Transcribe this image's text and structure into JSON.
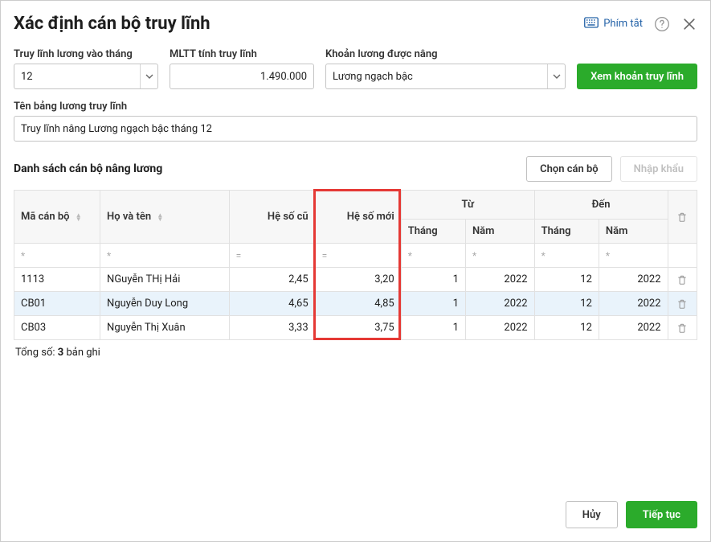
{
  "dialog": {
    "title": "Xác định cán bộ truy lĩnh",
    "shortcut_label": "Phím tắt"
  },
  "filters": {
    "month": {
      "label": "Truy lĩnh lương vào tháng",
      "value": "12"
    },
    "mltt": {
      "label": "MLTT tính truy lĩnh",
      "value": "1.490.000"
    },
    "salary_item": {
      "label": "Khoản lương được nâng",
      "value": "Lương ngạch bậc"
    },
    "view_btn": "Xem khoản truy lĩnh"
  },
  "name_field": {
    "label": "Tên bảng lương truy lĩnh",
    "value": "Truy lĩnh nâng Lương ngạch bậc tháng 12"
  },
  "section": {
    "title": "Danh sách cán bộ nâng lương",
    "choose_btn": "Chọn cán bộ",
    "import_btn": "Nhập khẩu"
  },
  "table": {
    "cols": {
      "code": "Mã cán bộ",
      "name": "Họ và tên",
      "old": "Hệ số cũ",
      "new": "Hệ số mới",
      "from": "Từ",
      "to": "Đến",
      "month": "Tháng",
      "year": "Năm"
    },
    "filters": {
      "star": "*",
      "eq": "="
    },
    "rows": [
      {
        "code": "1113",
        "name": "NGuyễn THị Hải",
        "old": "2,45",
        "new": "3,20",
        "fm": "1",
        "fy": "2022",
        "tm": "12",
        "ty": "2022",
        "highlight": false
      },
      {
        "code": "CB01",
        "name": "Nguyễn Duy Long",
        "old": "4,65",
        "new": "4,85",
        "fm": "1",
        "fy": "2022",
        "tm": "12",
        "ty": "2022",
        "highlight": true
      },
      {
        "code": "CB03",
        "name": "Nguyễn Thị Xuân",
        "old": "3,33",
        "new": "3,75",
        "fm": "1",
        "fy": "2022",
        "tm": "12",
        "ty": "2022",
        "highlight": false
      }
    ]
  },
  "summary": {
    "prefix": "Tổng số: ",
    "count": "3",
    "suffix": " bản ghi"
  },
  "footer": {
    "cancel": "Hủy",
    "continue": "Tiếp tục"
  }
}
